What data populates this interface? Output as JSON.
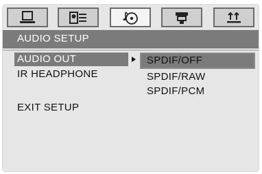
{
  "tabs": [
    {
      "icon": "monitor-icon",
      "active": false
    },
    {
      "icon": "language-icon",
      "active": false
    },
    {
      "icon": "audio-disc-icon",
      "active": true
    },
    {
      "icon": "video-camera-icon",
      "active": false
    },
    {
      "icon": "preference-icon",
      "active": false
    }
  ],
  "header": {
    "title": "AUDIO SETUP"
  },
  "menu": {
    "items": [
      "AUDIO OUT",
      "IR HEADPHONE",
      "EXIT SETUP"
    ],
    "selected_index": 0
  },
  "options": {
    "items": [
      "SPDIF/OFF",
      "SPDIF/RAW",
      "SPDIF/PCM"
    ],
    "selected_index": 0
  },
  "colors": {
    "background": "#e6e6e6",
    "highlight": "#7b7b7b",
    "tab_border": "#6b6b6b"
  }
}
